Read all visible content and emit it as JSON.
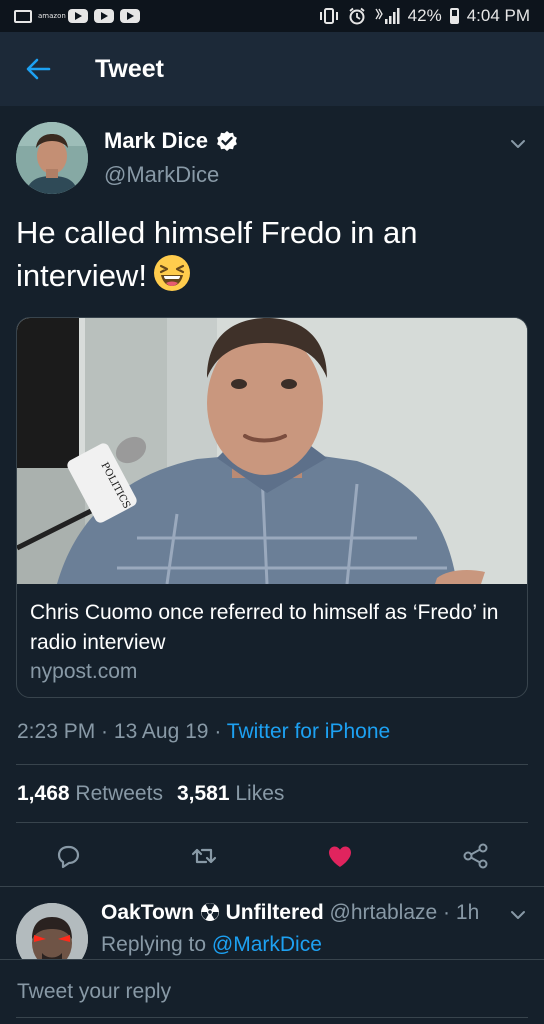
{
  "status_bar": {
    "battery": "42%",
    "time": "4:04 PM",
    "icons": [
      "message-icon",
      "amazon-icon",
      "youtube-icon",
      "vibrate-icon",
      "alarm-icon",
      "signal-icon",
      "battery-icon"
    ],
    "amazon_text": "amazon"
  },
  "header": {
    "title": "Tweet",
    "back_icon": "arrow-left-icon"
  },
  "tweet": {
    "author_name": "Mark Dice",
    "author_handle": "@MarkDice",
    "text": "He called himself Fredo in an interview!",
    "emoji": "laughing-face-emoji",
    "card": {
      "title": "Chris Cuomo once referred to himself as ‘Fredo’ in radio interview",
      "domain": "nypost.com",
      "mic_label": "POLITICS"
    },
    "time": "2:23 PM",
    "date": "13 Aug 19",
    "source": "Twitter for iPhone",
    "retweets_count": "1,468",
    "retweets_label": "Retweets",
    "likes_count": "3,581",
    "likes_label": "Likes",
    "liked": true
  },
  "actions": [
    "reply-icon",
    "retweet-icon",
    "like-icon",
    "share-icon"
  ],
  "colors": {
    "accent": "#1da1f2",
    "like": "#e0245e",
    "background": "#15202b",
    "muted": "#8899a6"
  },
  "reply": {
    "name_part1": "OakTown",
    "name_part2": "Unfiltered",
    "handle": "@hrtablaze",
    "time": "1h",
    "replying_prefix": "Replying to",
    "replying_handle": "@MarkDice"
  },
  "compose": {
    "placeholder": "Tweet your reply"
  }
}
